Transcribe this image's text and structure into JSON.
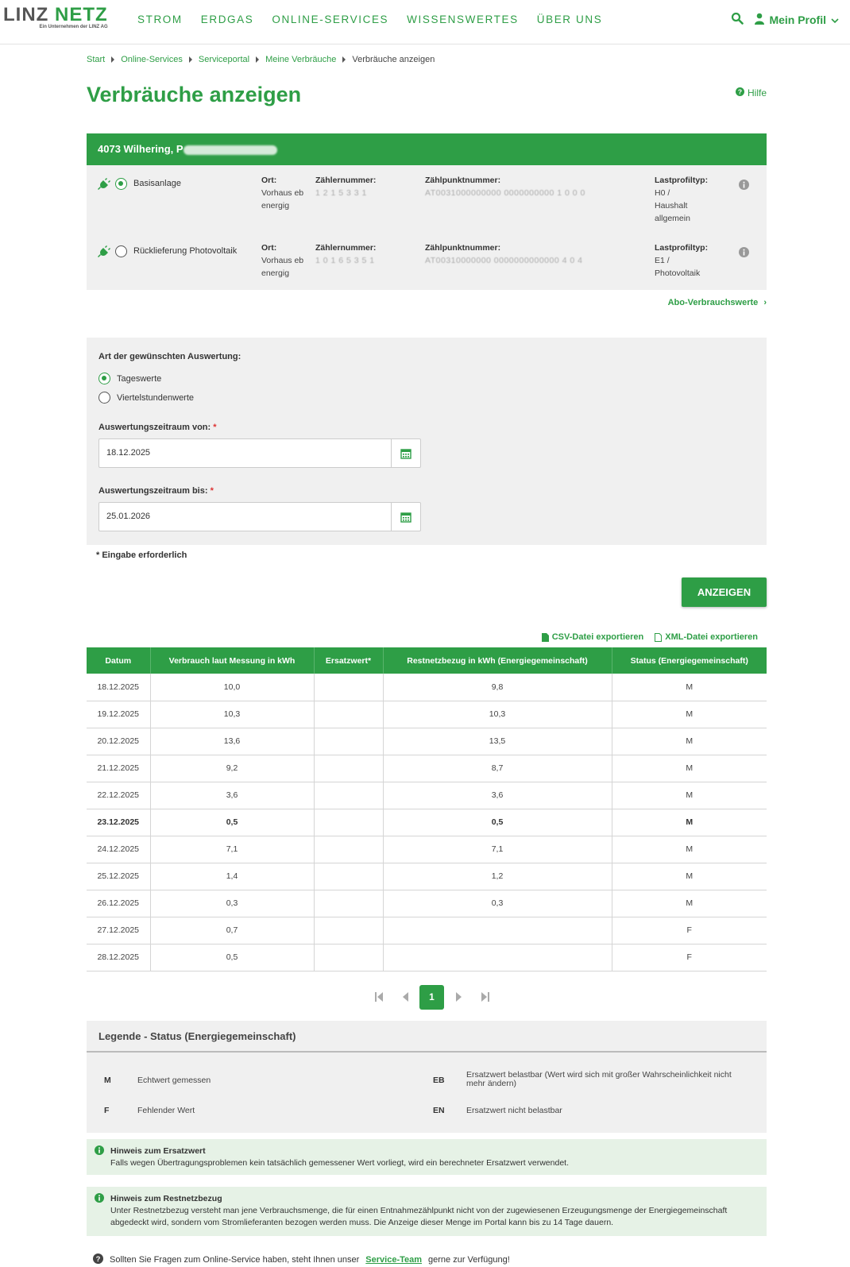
{
  "header": {
    "logo_main_1": "LINZ",
    "logo_main_2": "NETZ",
    "logo_sub": "Ein Unternehmen der LINZ AG",
    "nav": [
      "STROM",
      "ERDGAS",
      "ONLINE-SERVICES",
      "WISSENSWERTES",
      "ÜBER UNS"
    ],
    "profile_label": "Mein Profil"
  },
  "breadcrumb": [
    "Start",
    "Online-Services",
    "Serviceportal",
    "Meine Verbräuche",
    "Verbräuche anzeigen"
  ],
  "page": {
    "title": "Verbräuche anzeigen",
    "help": "Hilfe"
  },
  "installation": {
    "address": "4073 Wilhering, P",
    "rows": [
      {
        "name": "Basisanlage",
        "selected": true,
        "ort_label": "Ort:",
        "ort": [
          "Vorhaus eb",
          "energig"
        ],
        "zaehler_label": "Zählernummer:",
        "zaehler": "1 2 1 5 3 3 1",
        "zp_label": "Zählpunktnummer:",
        "zp": "AT0031000000000 0000000000 1 0 0 0",
        "lp_label": "Lastprofiltyp:",
        "lp": [
          "H0 /",
          "Haushalt",
          "allgemein"
        ]
      },
      {
        "name": "Rücklieferung Photovoltaik",
        "selected": false,
        "ort_label": "Ort:",
        "ort": [
          "Vorhaus eb",
          "energig"
        ],
        "zaehler_label": "Zählernummer:",
        "zaehler": "1 0 1 6 5 3 5 1",
        "zp_label": "Zählpunktnummer:",
        "zp": "AT00310000000 0000000000000 4 0 4",
        "lp_label": "Lastprofiltyp:",
        "lp": [
          "E1 /",
          "Photovoltaik"
        ]
      }
    ],
    "abo_link": "Abo-Verbrauchswerte"
  },
  "form": {
    "art_label": "Art der gewünschten Auswertung:",
    "options": [
      "Tageswerte",
      "Viertelstundenwerte"
    ],
    "from_label": "Auswertungszeitraum von:",
    "from_value": "18.12.2025",
    "to_label": "Auswertungszeitraum bis:",
    "to_value": "25.01.2026",
    "required_star": "*",
    "required_note": "* Eingabe erforderlich",
    "submit": "ANZEIGEN"
  },
  "exports": {
    "csv": "CSV-Datei exportieren",
    "xml": "XML-Datei exportieren"
  },
  "table": {
    "headers": [
      "Datum",
      "Verbrauch laut Messung in kWh",
      "Ersatzwert*",
      "Restnetzbezug in kWh (Energiegemeinschaft)",
      "Status (Energiegemeinschaft)"
    ],
    "rows": [
      [
        "18.12.2025",
        "10,0",
        "",
        "9,8",
        "M"
      ],
      [
        "19.12.2025",
        "10,3",
        "",
        "10,3",
        "M"
      ],
      [
        "20.12.2025",
        "13,6",
        "",
        "13,5",
        "M"
      ],
      [
        "21.12.2025",
        "9,2",
        "",
        "8,7",
        "M"
      ],
      [
        "22.12.2025",
        "3,6",
        "",
        "3,6",
        "M"
      ],
      [
        "23.12.2025",
        "0,5",
        "",
        "0,5",
        "M"
      ],
      [
        "24.12.2025",
        "7,1",
        "",
        "7,1",
        "M"
      ],
      [
        "25.12.2025",
        "1,4",
        "",
        "1,2",
        "M"
      ],
      [
        "26.12.2025",
        "0,3",
        "",
        "0,3",
        "M"
      ],
      [
        "27.12.2025",
        "0,7",
        "",
        "",
        "F"
      ],
      [
        "28.12.2025",
        "0,5",
        "",
        "",
        "F"
      ]
    ]
  },
  "pager": {
    "current": "1"
  },
  "legend": {
    "title": "Legende - Status (Energiegemeinschaft)",
    "items": [
      {
        "code": "M",
        "text": "Echtwert gemessen"
      },
      {
        "code": "F",
        "text": "Fehlender Wert"
      },
      {
        "code": "EB",
        "text": "Ersatzwert belastbar (Wert wird sich mit großer Wahrscheinlichkeit nicht mehr ändern)"
      },
      {
        "code": "EN",
        "text": "Ersatzwert nicht belastbar"
      }
    ]
  },
  "notes": [
    {
      "title": "Hinweis zum Ersatzwert",
      "text": "Falls wegen Übertragungsproblemen kein tatsächlich gemessener Wert vorliegt, wird ein berechneter Ersatzwert verwendet."
    },
    {
      "title": "Hinweis zum Restnetzbezug",
      "text": "Unter Restnetzbezug versteht man jene Verbrauchsmenge, die für einen Entnahmezählpunkt nicht von der zugewiesenen Erzeugungsmenge der Energiegemeinschaft abgedeckt wird, sondern vom Stromlieferanten bezogen werden muss. Die Anzeige dieser Menge im Portal kann bis zu 14 Tage dauern."
    }
  ],
  "footer": {
    "text_before": "Sollten Sie Fragen zum Online-Service haben, steht Ihnen unser",
    "link": "Service-Team",
    "text_after": "gerne zur Verfügung!"
  },
  "colors": {
    "brand_green": "#2e9e46",
    "panel_gray": "#f0f0f0",
    "note_green": "#e6f2e6"
  }
}
